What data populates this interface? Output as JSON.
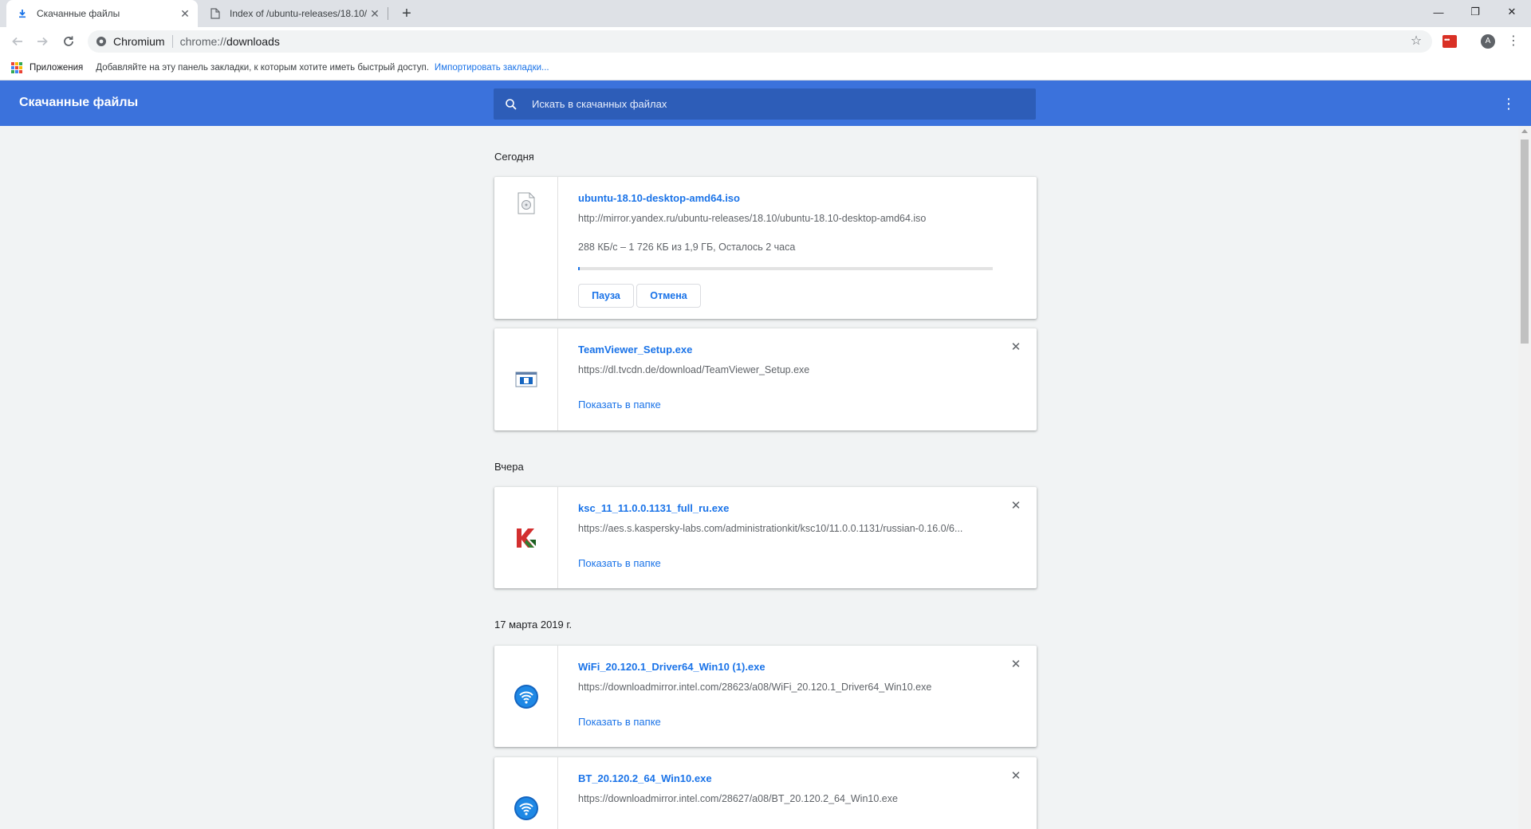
{
  "tabs": [
    {
      "title": "Скачанные файлы",
      "icon": "download-icon",
      "close": "✕"
    },
    {
      "title": "Index of /ubuntu-releases/18.10/",
      "icon": "page-icon",
      "close": "✕"
    }
  ],
  "new_tab": "+",
  "window_controls": {
    "minimize": "—",
    "maximize": "❐",
    "close": "✕"
  },
  "omnibox": {
    "site_label": "Chromium",
    "url_scheme": "chrome://",
    "url_path": "downloads"
  },
  "bookmarks_bar": {
    "apps_label": "Приложения",
    "hint": "Добавляйте на эту панель закладки, к которым хотите иметь быстрый доступ.",
    "import_link": "Импортировать закладки..."
  },
  "profile_initial": "A",
  "header": {
    "title": "Скачанные файлы",
    "search_placeholder": "Искать в скачанных файлах"
  },
  "groups": [
    {
      "date": "Сегодня",
      "items": [
        {
          "name": "ubuntu-18.10-desktop-amd64.iso",
          "url": "http://mirror.yandex.ru/ubuntu-releases/18.10/ubuntu-18.10-desktop-amd64.iso",
          "status": "288 КБ/с – 1 726 КБ из 1,9 ГБ, Осталось 2 часа",
          "progress": 0.001,
          "pause_label": "Пауза",
          "cancel_label": "Отмена",
          "icon": "disc-file-icon"
        },
        {
          "name": "TeamViewer_Setup.exe",
          "url": "https://dl.tvcdn.de/download/TeamViewer_Setup.exe",
          "show_label": "Показать в папке",
          "icon": "installer-icon"
        }
      ]
    },
    {
      "date": "Вчера",
      "items": [
        {
          "name": "ksc_11_11.0.0.1131_full_ru.exe",
          "url": "https://aes.s.kaspersky-labs.com/administrationkit/ksc10/11.0.0.1131/russian-0.16.0/6...",
          "show_label": "Показать в папке",
          "icon": "kaspersky-icon"
        }
      ]
    },
    {
      "date": "17 марта 2019 г.",
      "items": [
        {
          "name": "WiFi_20.120.1_Driver64_Win10 (1).exe",
          "url": "https://downloadmirror.intel.com/28623/a08/WiFi_20.120.1_Driver64_Win10.exe",
          "show_label": "Показать в папке",
          "icon": "wifi-icon"
        },
        {
          "name": "BT_20.120.2_64_Win10.exe",
          "url": "https://downloadmirror.intel.com/28627/a08/BT_20.120.2_64_Win10.exe",
          "icon": "wifi-icon"
        }
      ]
    }
  ],
  "colors": {
    "header_blue": "#3b72dc",
    "search_blue": "#2d5db8",
    "link_blue": "#1a73e8"
  }
}
